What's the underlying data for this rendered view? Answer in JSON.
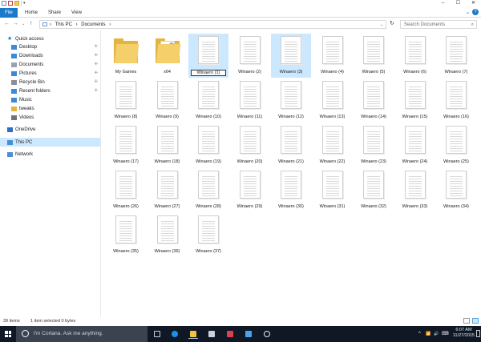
{
  "window": {
    "controls": {
      "minimize": "–",
      "maximize": "☐",
      "close": "✕"
    }
  },
  "ribbon": {
    "tabs": [
      "File",
      "Home",
      "Share",
      "View"
    ],
    "expand": "⌄",
    "help": "?"
  },
  "address": {
    "back": "←",
    "forward": "→",
    "recent": "⌄",
    "up": "↑",
    "crumbs": [
      "›",
      "This PC",
      "›",
      "Documents",
      "›"
    ],
    "dropdown": "⌄",
    "refresh": "↻",
    "search_placeholder": "Search Documents",
    "search_icon": "⌕"
  },
  "navpane": {
    "items": [
      {
        "label": "Quick access",
        "icon": "star-icon",
        "color": "#1979ca",
        "pinned": false
      },
      {
        "label": "Desktop",
        "icon": "desktop-icon",
        "color": "#3b8ad8",
        "pinned": true
      },
      {
        "label": "Downloads",
        "icon": "download-icon",
        "color": "#3b8ad8",
        "pinned": true
      },
      {
        "label": "Documents",
        "icon": "documents-icon",
        "color": "#9aa3ad",
        "pinned": true
      },
      {
        "label": "Pictures",
        "icon": "pictures-icon",
        "color": "#3b8ad8",
        "pinned": true
      },
      {
        "label": "Recycle Bin",
        "icon": "recycle-bin-icon",
        "color": "#8b9098",
        "pinned": true
      },
      {
        "label": "Recent folders",
        "icon": "recent-folders-icon",
        "color": "#3b8ad8",
        "pinned": true
      },
      {
        "label": "Music",
        "icon": "music-icon",
        "color": "#3b8ad8",
        "pinned": false
      },
      {
        "label": "tweaks",
        "icon": "folder-icon",
        "color": "#e2b441",
        "pinned": false
      },
      {
        "label": "Videos",
        "icon": "videos-icon",
        "color": "#6d7480",
        "pinned": false
      },
      {
        "label": "OneDrive",
        "icon": "onedrive-icon",
        "color": "#2f6fc2",
        "pinned": false
      },
      {
        "label": "This PC",
        "icon": "this-pc-icon",
        "color": "#4a8fd6",
        "pinned": false
      },
      {
        "label": "Network",
        "icon": "network-icon",
        "color": "#4a8fd6",
        "pinned": false
      }
    ],
    "pin_glyph": "📌"
  },
  "files": [
    {
      "name": "My Games",
      "type": "folder"
    },
    {
      "name": "x64",
      "type": "folder-art"
    },
    {
      "name": "Winaero (1)",
      "type": "doc",
      "state": "renaming"
    },
    {
      "name": "Winaero (2)",
      "type": "doc"
    },
    {
      "name": "Winaero (3)",
      "type": "doc",
      "state": "hover"
    },
    {
      "name": "Winaero (4)",
      "type": "doc"
    },
    {
      "name": "Winaero (5)",
      "type": "doc"
    },
    {
      "name": "Winaero (6)",
      "type": "doc"
    },
    {
      "name": "Winaero (7)",
      "type": "doc"
    },
    {
      "name": "Winaero (8)",
      "type": "doc"
    },
    {
      "name": "Winaero (9)",
      "type": "doc"
    },
    {
      "name": "Winaero (10)",
      "type": "doc"
    },
    {
      "name": "Winaero (11)",
      "type": "doc"
    },
    {
      "name": "Winaero (12)",
      "type": "doc"
    },
    {
      "name": "Winaero (13)",
      "type": "doc"
    },
    {
      "name": "Winaero (14)",
      "type": "doc"
    },
    {
      "name": "Winaero (15)",
      "type": "doc"
    },
    {
      "name": "Winaero (16)",
      "type": "doc"
    },
    {
      "name": "Winaero (17)",
      "type": "doc"
    },
    {
      "name": "Winaero (18)",
      "type": "doc"
    },
    {
      "name": "Winaero (19)",
      "type": "doc"
    },
    {
      "name": "Winaero (20)",
      "type": "doc"
    },
    {
      "name": "Winaero (21)",
      "type": "doc"
    },
    {
      "name": "Winaero (22)",
      "type": "doc"
    },
    {
      "name": "Winaero (23)",
      "type": "doc"
    },
    {
      "name": "Winaero (24)",
      "type": "doc"
    },
    {
      "name": "Winaero (25)",
      "type": "doc"
    },
    {
      "name": "Winaero (26)",
      "type": "doc"
    },
    {
      "name": "Winaero (27)",
      "type": "doc"
    },
    {
      "name": "Winaero (28)",
      "type": "doc"
    },
    {
      "name": "Winaero (29)",
      "type": "doc"
    },
    {
      "name": "Winaero (30)",
      "type": "doc"
    },
    {
      "name": "Winaero (31)",
      "type": "doc"
    },
    {
      "name": "Winaero (32)",
      "type": "doc"
    },
    {
      "name": "Winaero (33)",
      "type": "doc"
    },
    {
      "name": "Winaero (34)",
      "type": "doc"
    },
    {
      "name": "Winaero (35)",
      "type": "doc"
    },
    {
      "name": "Winaero (36)",
      "type": "doc"
    },
    {
      "name": "Winaero (37)",
      "type": "doc"
    }
  ],
  "status": {
    "count": "39 items",
    "selection": "1 item selected  0 bytes"
  },
  "taskbar": {
    "cortana_placeholder": "I'm Cortana. Ask me anything.",
    "apps": [
      "task-view-icon",
      "edge-icon",
      "file-explorer-icon",
      "store-icon",
      "paint-icon",
      "tool-icon",
      "settings-icon"
    ],
    "tray": {
      "chevron": "^",
      "network": "📶",
      "volume": "🔊",
      "keyboard": "⌨"
    },
    "time": "6:07 AM",
    "date": "11/27/2015"
  },
  "colors": {
    "accent": "#1979ca",
    "selection": "#cce8ff",
    "taskbar": "#101826",
    "cortana_box": "#3c4350"
  }
}
